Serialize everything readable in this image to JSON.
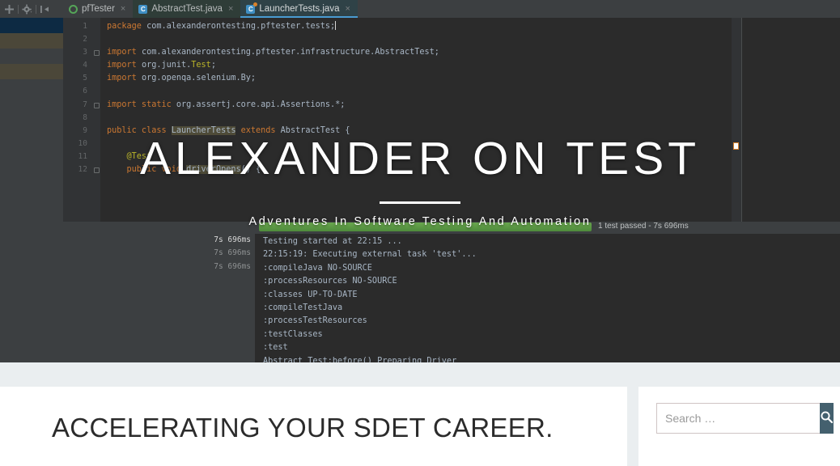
{
  "hero": {
    "site_title": "ALEXANDER ON TEST",
    "tagline": "Adventures In Software Testing And Automation"
  },
  "ide": {
    "toolbar_icons": [
      "expand-all-icon",
      "settings-gear-icon",
      "collapse-panel-icon"
    ],
    "tabs": [
      {
        "label": "pfTester",
        "icon": "module-icon",
        "close": "×",
        "active": false
      },
      {
        "label": "AbstractTest.java",
        "icon": "java-class-icon",
        "close": "×",
        "active": false
      },
      {
        "label": "LauncherTests.java",
        "icon": "java-runnable-class-icon",
        "close": "×",
        "active": true
      }
    ],
    "gutter_lines": [
      "1",
      "2",
      "3",
      "4",
      "5",
      "6",
      "7",
      "8",
      "9",
      "10",
      "11",
      "12"
    ],
    "run_markers": {
      "9": "»",
      "12": "▶"
    },
    "code_lines": [
      {
        "n": 1,
        "tokens": [
          {
            "t": "package ",
            "c": "kw"
          },
          {
            "t": "com.alexanderontesting.pftester.tests;",
            "c": "pl"
          }
        ],
        "caret": true
      },
      {
        "n": 2,
        "tokens": []
      },
      {
        "n": 3,
        "fold": true,
        "tokens": [
          {
            "t": "import ",
            "c": "kw"
          },
          {
            "t": "com.alexanderontesting.pftester.infrastructure.AbstractTest;",
            "c": "pl"
          }
        ]
      },
      {
        "n": 4,
        "tokens": [
          {
            "t": "import ",
            "c": "kw"
          },
          {
            "t": "org.junit.",
            "c": "pl"
          },
          {
            "t": "Test",
            "c": "an"
          },
          {
            "t": ";",
            "c": "pl"
          }
        ]
      },
      {
        "n": 5,
        "tokens": [
          {
            "t": "import ",
            "c": "kw"
          },
          {
            "t": "org.openqa.selenium.By;",
            "c": "pl"
          }
        ]
      },
      {
        "n": 6,
        "tokens": []
      },
      {
        "n": 7,
        "fold": true,
        "tokens": [
          {
            "t": "import static ",
            "c": "kw"
          },
          {
            "t": "org.assertj.core.api.Assertions.*;",
            "c": "pl"
          }
        ]
      },
      {
        "n": 8,
        "tokens": []
      },
      {
        "n": 9,
        "tokens": [
          {
            "t": "public class ",
            "c": "kw"
          },
          {
            "t": "LauncherTests",
            "c": "pl hl"
          },
          {
            "t": " extends ",
            "c": "kw"
          },
          {
            "t": "AbstractTest {",
            "c": "pl"
          }
        ]
      },
      {
        "n": 10,
        "tokens": []
      },
      {
        "n": 11,
        "tokens": [
          {
            "t": "    @Test",
            "c": "an"
          }
        ]
      },
      {
        "n": 12,
        "fold": true,
        "tokens": [
          {
            "t": "    public void ",
            "c": "kw"
          },
          {
            "t": "driverOpens",
            "c": "pl hl"
          },
          {
            "t": "() {",
            "c": "pl"
          }
        ]
      }
    ],
    "run_panel": {
      "progress_label": "1 test passed - 7s 696ms",
      "durations": [
        "7s 696ms",
        "7s 696ms",
        "7s 696ms"
      ],
      "console_lines": [
        "Testing started at 22:15 ...",
        "22:15:19: Executing external task 'test'...",
        ":compileJava NO-SOURCE",
        ":processResources NO-SOURCE",
        ":classes UP-TO-DATE",
        ":compileTestJava",
        ":processTestResources",
        ":testClasses",
        ":test",
        "Abstract Test:before() Preparing Driver"
      ]
    }
  },
  "main": {
    "headline": "ACCELERATING YOUR SDET CAREER."
  },
  "sidebar": {
    "search_placeholder": "Search …",
    "search_value": "",
    "search_button_icon": "search-icon"
  },
  "colors": {
    "accent_green": "#6aa84f",
    "tab_active_underline": "#4a9bd1",
    "search_button": "#44606e",
    "band": "#eaeef0",
    "editor_bg": "#2b2b2b"
  }
}
